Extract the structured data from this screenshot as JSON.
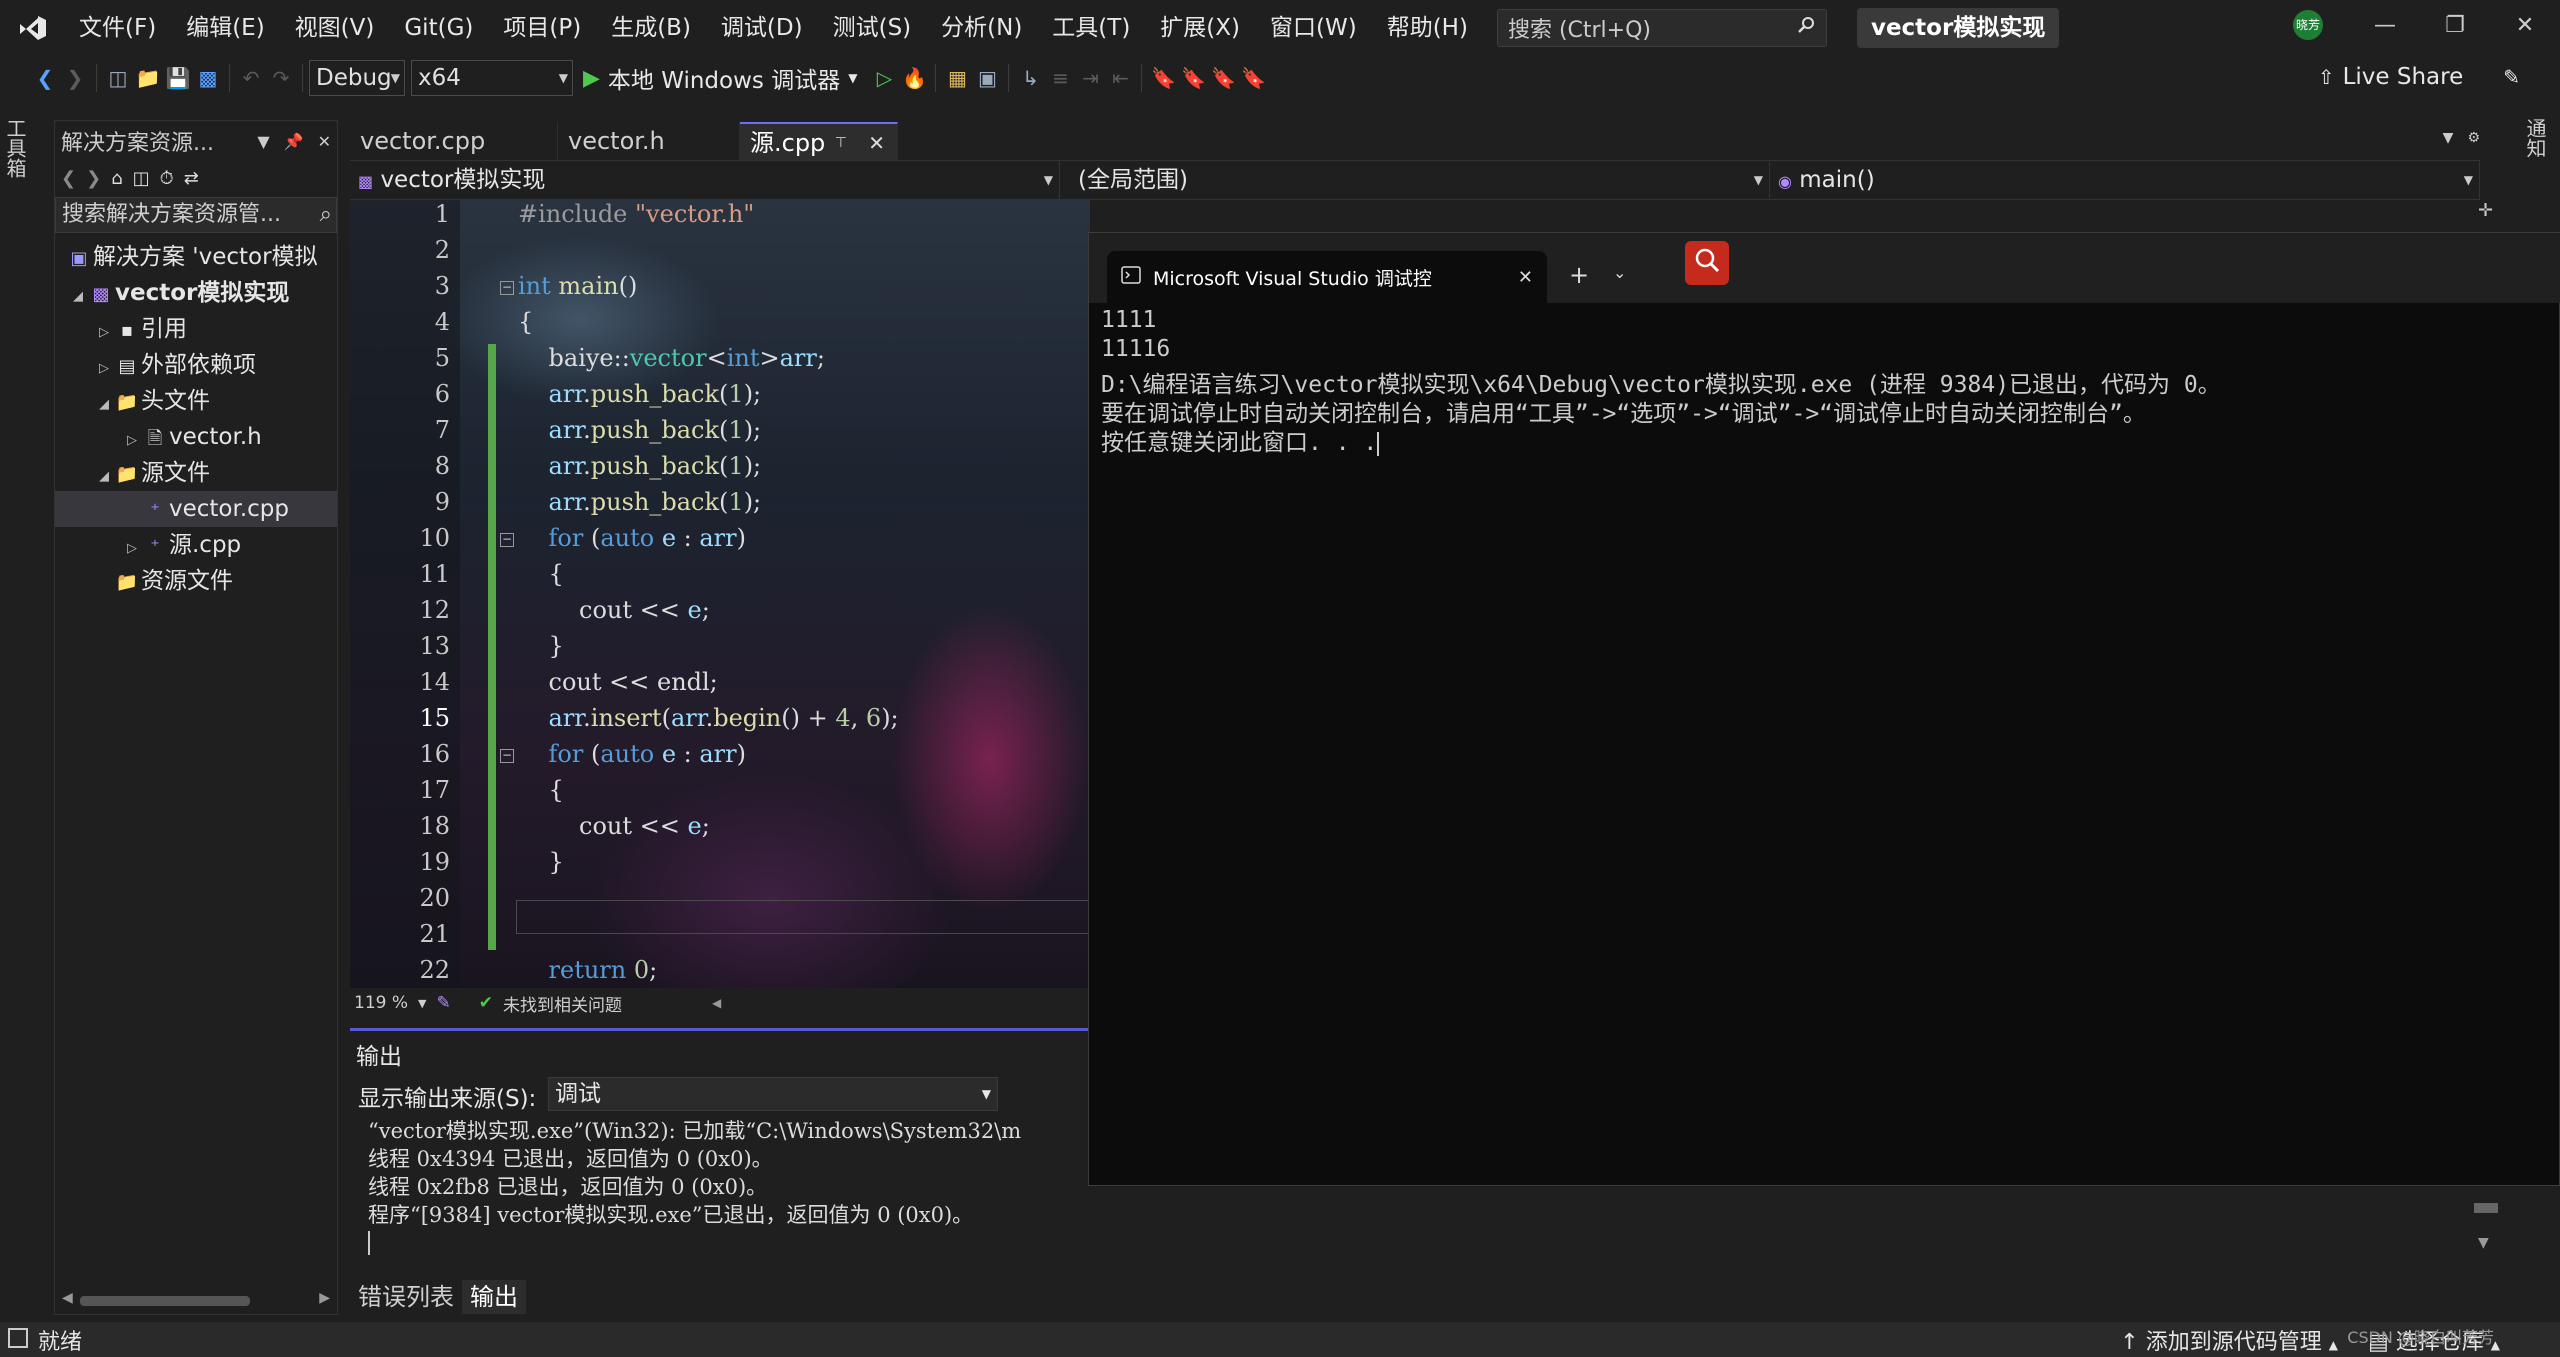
{
  "menu": {
    "items": [
      "文件(F)",
      "编辑(E)",
      "视图(V)",
      "Git(G)",
      "项目(P)",
      "生成(B)",
      "调试(D)",
      "测试(S)",
      "分析(N)",
      "工具(T)",
      "扩展(X)",
      "窗口(W)",
      "帮助(H)"
    ],
    "search_placeholder": "搜索 (Ctrl+Q)",
    "solution_title": "vector模拟实现",
    "account_initials": "晓芳"
  },
  "toolbar": {
    "config": "Debug",
    "platform": "x64",
    "run_label": "本地 Windows 调试器",
    "live_share": "Live Share"
  },
  "side_strips": {
    "toolbox": "工具箱",
    "notifications": "通知"
  },
  "solution_explorer": {
    "title": "解决方案资源...",
    "search_placeholder": "搜索解决方案资源管...",
    "tree": [
      {
        "label": "解决方案 'vector模拟",
        "icon": "solution-icon"
      },
      {
        "label": "vector模拟实现",
        "icon": "project-icon"
      },
      {
        "label": "引用",
        "icon": "references-icon"
      },
      {
        "label": "外部依赖项",
        "icon": "external-deps-icon"
      },
      {
        "label": "头文件",
        "icon": "folder-icon"
      },
      {
        "label": "vector.h",
        "icon": "header-file-icon"
      },
      {
        "label": "源文件",
        "icon": "folder-icon"
      },
      {
        "label": "vector.cpp",
        "icon": "cpp-file-icon"
      },
      {
        "label": "源.cpp",
        "icon": "cpp-file-icon"
      },
      {
        "label": "资源文件",
        "icon": "folder-icon"
      }
    ]
  },
  "editor": {
    "tabs": [
      "vector.cpp",
      "vector.h",
      "源.cpp"
    ],
    "nav_project": "vector模拟实现",
    "nav_scope": "(全局范围)",
    "nav_function": "main()",
    "line_numbers": [
      "1",
      "2",
      "3",
      "4",
      "5",
      "6",
      "7",
      "8",
      "9",
      "10",
      "11",
      "12",
      "13",
      "14",
      "15",
      "16",
      "17",
      "18",
      "19",
      "20",
      "21",
      "22"
    ],
    "current_line": 15,
    "zoom": "119 %",
    "issues": "未找到相关问题"
  },
  "output": {
    "title": "输出",
    "source_label": "显示输出来源(S):",
    "source_value": "调试",
    "lines": [
      "“vector模拟实现.exe”(Win32): 已加载“C:\\Windows\\System32\\m",
      "线程 0x4394 已退出，返回值为 0 (0x0)。",
      "线程 0x2fb8 已退出，返回值为 0 (0x0)。",
      "程序“[9384] vector模拟实现.exe”已退出，返回值为 0 (0x0)。"
    ],
    "bottom_tabs": [
      "错误列表",
      "输出"
    ]
  },
  "status": {
    "ready": "就绪",
    "source_control": "添加到源代码管理",
    "repo": "选择仓库",
    "watermark": "CSDN @晓白叫芳芳"
  },
  "console": {
    "tab_title": "Microsoft Visual Studio 调试控",
    "lines": [
      "1111",
      "11116",
      "D:\\编程语言练习\\vector模拟实现\\x64\\Debug\\vector模拟实现.exe (进程 9384)已退出，代码为 0。",
      "要在调试停止时自动关闭控制台，请启用“工具”->“选项”->“调试”->“调试停止时自动关闭控制台”。",
      "按任意键关闭此窗口. . ."
    ]
  },
  "colors": {
    "accent": "#6c6cff",
    "change_bar": "#57a64a",
    "console_search": "#c42b1c"
  }
}
